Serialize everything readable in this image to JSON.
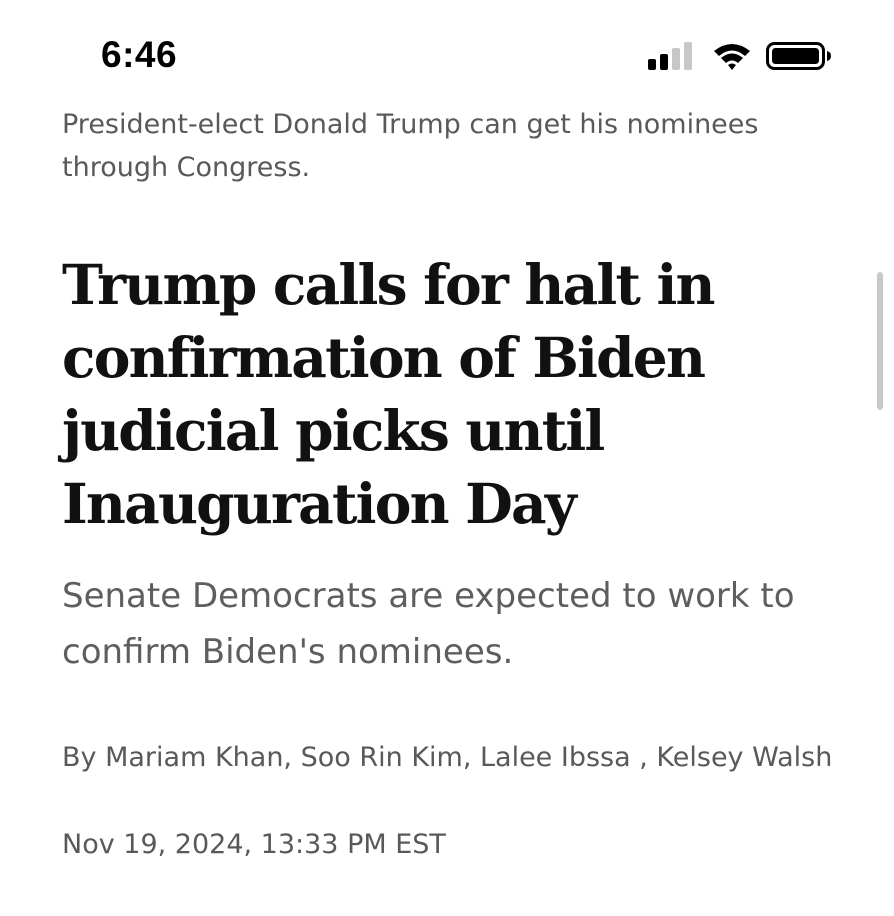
{
  "status_bar": {
    "time": "6:46",
    "icons": [
      "cellular-signal-icon",
      "wifi-icon",
      "battery-icon"
    ],
    "signal_bars_active": 2,
    "signal_bars_total": 4
  },
  "article": {
    "previous_summary": "President-elect Donald Trump can get his nominees through Congress.",
    "headline": "Trump calls for halt in confirmation of Biden judicial picks until Inauguration Day",
    "subheadline": "Senate Democrats are expected to work to confirm Biden's nominees.",
    "byline": "By Mariam Khan, Soo Rin Kim, Lalee Ibssa , Kelsey Walsh",
    "timestamp": "Nov 19, 2024, 13:33 PM EST"
  },
  "colors": {
    "background": "#ffffff",
    "headline": "#111111",
    "body_text": "#595959",
    "scrollbar": "#c9c9c9"
  }
}
